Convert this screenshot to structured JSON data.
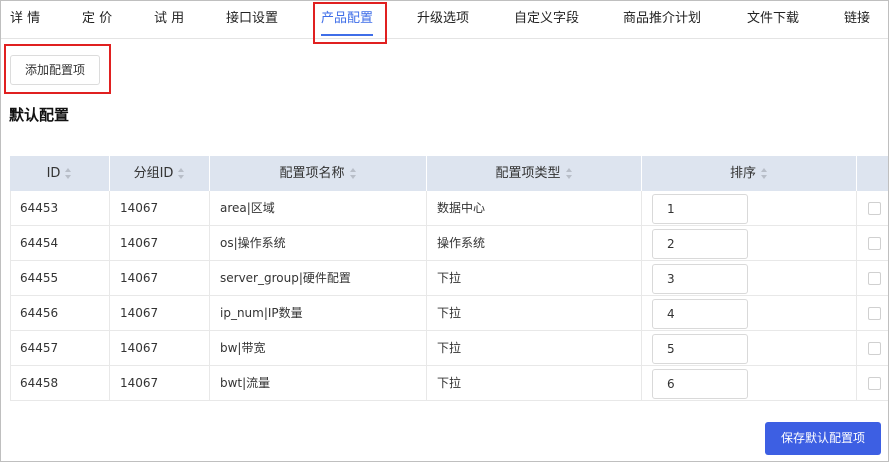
{
  "tabs": [
    {
      "label": "详 情",
      "active": false
    },
    {
      "label": "定 价",
      "active": false
    },
    {
      "label": "试 用",
      "active": false
    },
    {
      "label": "接口设置",
      "active": false
    },
    {
      "label": "产品配置",
      "active": true
    },
    {
      "label": "升级选项",
      "active": false
    },
    {
      "label": "自定义字段",
      "active": false
    },
    {
      "label": "商品推介计划",
      "active": false
    },
    {
      "label": "文件下载",
      "active": false
    },
    {
      "label": "链接",
      "active": false
    }
  ],
  "toolbar": {
    "add_label": "添加配置项"
  },
  "section": {
    "title": "默认配置"
  },
  "table": {
    "headers": {
      "id": "ID",
      "group_id": "分组ID",
      "name": "配置项名称",
      "type": "配置项类型",
      "order": "排序"
    },
    "rows": [
      {
        "id": "64453",
        "group_id": "14067",
        "name": "area|区域",
        "type": "数据中心",
        "order": "1"
      },
      {
        "id": "64454",
        "group_id": "14067",
        "name": "os|操作系统",
        "type": "操作系统",
        "order": "2"
      },
      {
        "id": "64455",
        "group_id": "14067",
        "name": "server_group|硬件配置",
        "type": "下拉",
        "order": "3"
      },
      {
        "id": "64456",
        "group_id": "14067",
        "name": "ip_num|IP数量",
        "type": "下拉",
        "order": "4"
      },
      {
        "id": "64457",
        "group_id": "14067",
        "name": "bw|带宽",
        "type": "下拉",
        "order": "5"
      },
      {
        "id": "64458",
        "group_id": "14067",
        "name": "bwt|流量",
        "type": "下拉",
        "order": "6"
      }
    ]
  },
  "footer": {
    "save_label": "保存默认配置项"
  },
  "colors": {
    "accent": "#3f6ee8",
    "primary_button": "#3d5fe3",
    "highlight": "#e02020",
    "table_header_bg": "#dde4ef"
  }
}
